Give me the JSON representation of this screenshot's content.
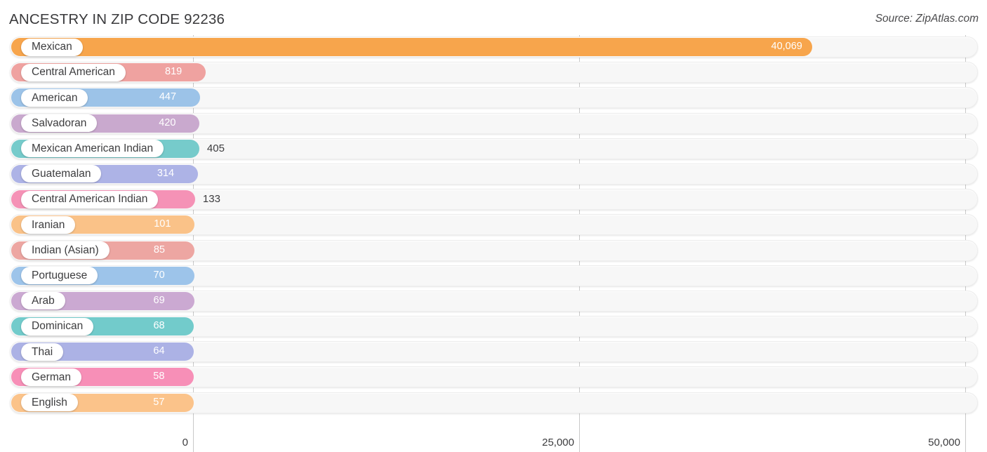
{
  "header": {
    "title": "ANCESTRY IN ZIP CODE 92236",
    "source": "Source: ZipAtlas.com"
  },
  "chart_data": {
    "type": "bar",
    "orientation": "horizontal",
    "title": "ANCESTRY IN ZIP CODE 92236",
    "xlabel": "",
    "ylabel": "",
    "xlim": [
      0,
      50000
    ],
    "grid": true,
    "legend": "none",
    "axis_ticks": [
      {
        "label": "0",
        "value": 0
      },
      {
        "label": "25,000",
        "value": 25000
      },
      {
        "label": "50,000",
        "value": 50000
      }
    ],
    "categories": [
      "Mexican",
      "Central American",
      "American",
      "Salvadoran",
      "Mexican American Indian",
      "Guatemalan",
      "Central American Indian",
      "Iranian",
      "Indian (Asian)",
      "Portuguese",
      "Arab",
      "Dominican",
      "Thai",
      "German",
      "English"
    ],
    "values": [
      40069,
      819,
      447,
      420,
      405,
      314,
      133,
      101,
      85,
      70,
      69,
      68,
      64,
      58,
      57
    ],
    "value_labels": [
      "40,069",
      "819",
      "447",
      "420",
      "405",
      "314",
      "133",
      "101",
      "85",
      "70",
      "69",
      "68",
      "64",
      "58",
      "57"
    ],
    "colors": [
      "#f5a css",
      "#f5a24a"
    ],
    "bar_colors": [
      "#f7a54c",
      "#efa2a0",
      "#9cc3e8",
      "#c9a9ce",
      "#76cbcb",
      "#adb3e6",
      "#f592b6",
      "#fac288",
      "#eda6a2",
      "#9dc4ea",
      "#cba9d2",
      "#72cbcb",
      "#acb2e5",
      "#f78fb7",
      "#fbc38a"
    ]
  },
  "axis": {
    "ticks": [
      "0",
      "25,000",
      "50,000"
    ]
  }
}
